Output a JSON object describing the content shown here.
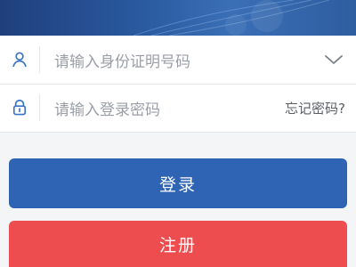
{
  "header": {
    "banner_icon": "blue-tech-banner"
  },
  "form": {
    "id_input": {
      "icon": "user-icon",
      "placeholder": "请输入身份证明号码",
      "dropdown_icon": "chevron-down-icon"
    },
    "password_input": {
      "icon": "lock-icon",
      "placeholder": "请输入登录密码",
      "forgot_label": "忘记密码?"
    }
  },
  "actions": {
    "login_label": "登录",
    "register_label": "注册"
  },
  "colors": {
    "primary": "#2f63b3",
    "danger": "#ee4d4f",
    "icon_blue": "#3a73c5"
  }
}
